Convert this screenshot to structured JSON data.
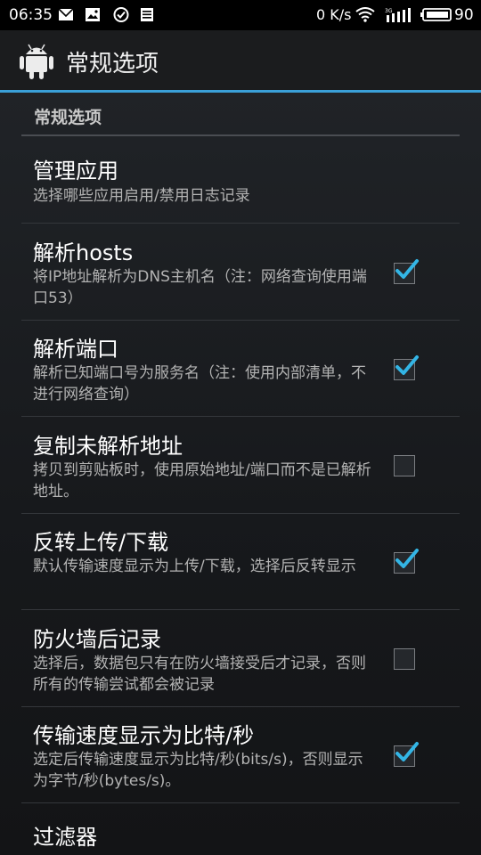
{
  "status_bar": {
    "time": "06:35",
    "net_speed": "0 K/s",
    "battery_level": "90",
    "icons": [
      "mail-icon",
      "image-notification-icon",
      "check-circle-icon",
      "document-icon",
      "wifi-icon",
      "signal-3g-icon",
      "battery-icon"
    ]
  },
  "action_bar": {
    "title": "常规选项",
    "icon": "android-icon"
  },
  "section": {
    "header": "常规选项"
  },
  "preferences": [
    {
      "title": "管理应用",
      "summary": "选择哪些应用启用/禁用日志记录",
      "checkbox": null
    },
    {
      "title": "解析hosts",
      "summary": "将IP地址解析为DNS主机名（注：网络查询使用端口53）",
      "checkbox": true
    },
    {
      "title": "解析端口",
      "summary": "解析已知端口号为服务名（注：使用内部清单，不进行网络查询）",
      "checkbox": true
    },
    {
      "title": "复制未解析地址",
      "summary": "拷贝到剪贴板时，使用原始地址/端口而不是已解析地址。",
      "checkbox": false
    },
    {
      "title": "反转上传/下载",
      "summary": "默认传输速度显示为上传/下载，选择后反转显示",
      "checkbox": true
    },
    {
      "title": "防火墙后记录",
      "summary": "选择后，数据包只有在防火墙接受后才记录，否则所有的传输尝试都会被记录",
      "checkbox": false
    },
    {
      "title": "传输速度显示为比特/秒",
      "summary": "选定后传输速度显示为比特/秒(bits/s)，否则显示为字节/秒(bytes/s)。",
      "checkbox": true
    },
    {
      "title": "过滤器",
      "summary": "",
      "checkbox": null
    }
  ],
  "colors": {
    "accent": "#3aa0d8",
    "check": "#33b5e5"
  }
}
